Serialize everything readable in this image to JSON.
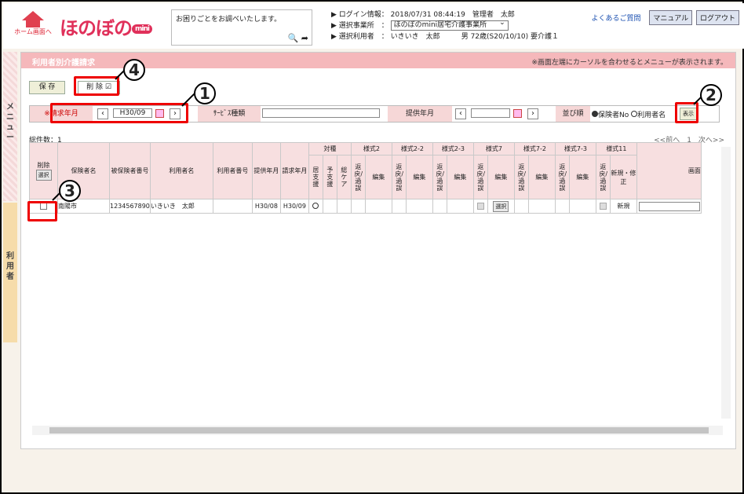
{
  "header": {
    "home_label": "ホーム画面へ",
    "logo_text": "ほのぼの",
    "logo_badge": "mini",
    "help_text": "お困りごとをお調べいたします。",
    "info": {
      "login_label": "▶ ログイン情報：",
      "login_value": "2018/07/31 08:44:19　管理者　太郎",
      "office_label": "▶ 選択事業所　：",
      "office_value": "ほのぼのmini居宅介護事業所",
      "user_label": "▶ 選択利用者　：",
      "user_name": "いきいき　太郎",
      "user_detail": "男 72歳(S20/10/10) 要介護１"
    },
    "faq_link": "よくあるご質問",
    "manual_button": "マニュアル",
    "logout_button": "ログアウト"
  },
  "side": {
    "menu_tab": "メニュー",
    "user_tab": "利用者"
  },
  "page": {
    "title": "利用者別介護請求",
    "note": "※画面左端にカーソルを合わせるとメニューが表示されます。",
    "save_button": "保 存",
    "delete_button": "削 除",
    "delete_mark": "☑"
  },
  "conditions": {
    "billing_month_label": "※請求年月",
    "billing_month_value": "H30/09",
    "service_type_label": "ｻｰﾋﾞｽ種類",
    "service_type_value": "",
    "provision_month_label": "提供年月",
    "provision_month_value": "",
    "sort_label": "並び順",
    "sort_option_1": "保険者No",
    "sort_option_2": "利用者名",
    "show_button": "表示"
  },
  "list": {
    "total": "総件数：1",
    "pager": "<<前へ　1　次へ>>"
  },
  "table": {
    "headers": {
      "delete": "削除",
      "select": "選択",
      "insurer": "保険者名",
      "insured_no": "被保険者番号",
      "user_name": "利用者名",
      "user_no": "利用者番号",
      "provide_month": "提供年月",
      "billing_month": "請求年月",
      "kind": "対種",
      "kind_1": "居支援",
      "kind_2": "予支援",
      "kind_3": "総ケア",
      "f2": "様式2",
      "f22": "様式2-2",
      "f23": "様式2-3",
      "f7": "様式7",
      "f72": "様式7-2",
      "f73": "様式7-3",
      "f11": "様式11",
      "screen": "画面",
      "return_err": "返戻/過誤",
      "edit": "編集",
      "new_mod": "新規・修正"
    },
    "rows": [
      {
        "insurer": "南陽市",
        "insured_no": "1234567890",
        "user_name": "いきいき　太郎",
        "user_no": "",
        "provide_month": "H30/08",
        "billing_month": "H30/09",
        "select": "選択",
        "status": "新規"
      }
    ]
  },
  "callouts": {
    "c1": "1",
    "c2": "2",
    "c3": "3",
    "c4": "4"
  },
  "colors": {
    "title_bar": "#f5b8bb",
    "highlight": "#e00000",
    "accent": "#e0305a"
  }
}
